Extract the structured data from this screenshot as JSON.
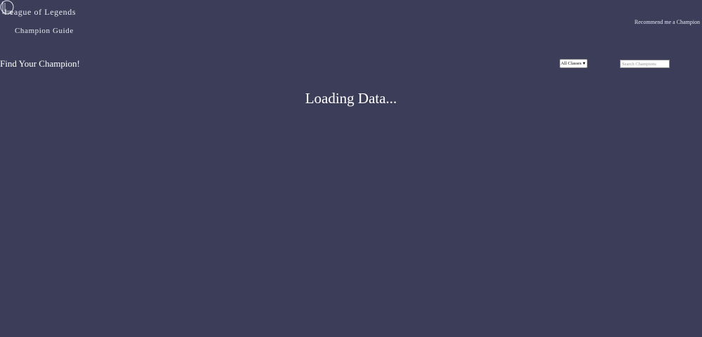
{
  "header": {
    "brand_line1": "League of Legends",
    "brand_line2": "Champion Guide",
    "recommend_link": "Recommend me a Champion",
    "logo_icon": "lol-logo-icon"
  },
  "filters": {
    "title": "Find Your Champion!",
    "class_select_value": "All Classes",
    "search_placeholder": "Search Champions"
  },
  "main": {
    "loading_text": "Loading Data..."
  },
  "colors": {
    "background": "#3c3d58",
    "text": "#ffffff"
  }
}
